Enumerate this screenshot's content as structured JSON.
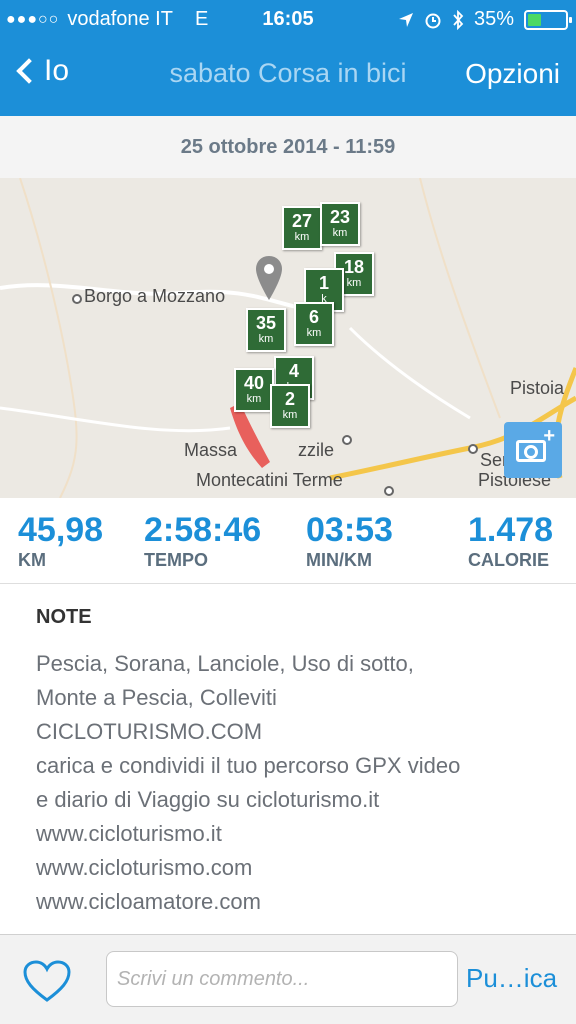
{
  "status": {
    "carrier": "vodafone IT",
    "network": "E",
    "time": "16:05",
    "battery_text": "35%",
    "battery_level": 0.35,
    "signal_dots": "●●●○○"
  },
  "nav": {
    "back_label": "Io",
    "title": "sabato Corsa in bici",
    "options_label": "Opzioni"
  },
  "date": "25 ottobre 2014 - 11:59",
  "map": {
    "places": [
      "Borgo a Mozzano",
      "Massa",
      "zzile",
      "Montecatini Terme",
      "Pistoia",
      "Serravalle",
      "Pistoiese"
    ],
    "markers": [
      {
        "n": "27",
        "u": "km"
      },
      {
        "n": "23",
        "u": "km"
      },
      {
        "n": "18",
        "u": "km"
      },
      {
        "n": "1",
        "u": "k"
      },
      {
        "n": "35",
        "u": "km"
      },
      {
        "n": "6",
        "u": "km"
      },
      {
        "n": "4",
        "u": "km"
      },
      {
        "n": "40",
        "u": "km"
      },
      {
        "n": "2",
        "u": "km"
      }
    ]
  },
  "stats": [
    {
      "value": "45,98",
      "label": "KM"
    },
    {
      "value": "2:58:46",
      "label": "TEMPO"
    },
    {
      "value": "03:53",
      "label": "MIN/KM"
    },
    {
      "value": "1.478",
      "label": "CALORIE"
    }
  ],
  "notes": {
    "heading": "NOTE",
    "lines": [
      "Pescia, Sorana, Lanciole, Uso di sotto,",
      "Monte a Pescia, Colleviti",
      "CICLOTURISMO.COM",
      "carica e condividi il tuo percorso GPX video",
      "e diario di Viaggio su cicloturismo.it",
      "www.cicloturismo.it",
      "www.cicloturismo.com",
      "www.cicloamatore.com"
    ]
  },
  "bottom": {
    "comment_placeholder": "Scrivi un commento...",
    "publish_label": "Pu…ica"
  },
  "colors": {
    "accent": "#1c8fd8",
    "marker": "#2f6b36",
    "route": "#e8605c"
  }
}
